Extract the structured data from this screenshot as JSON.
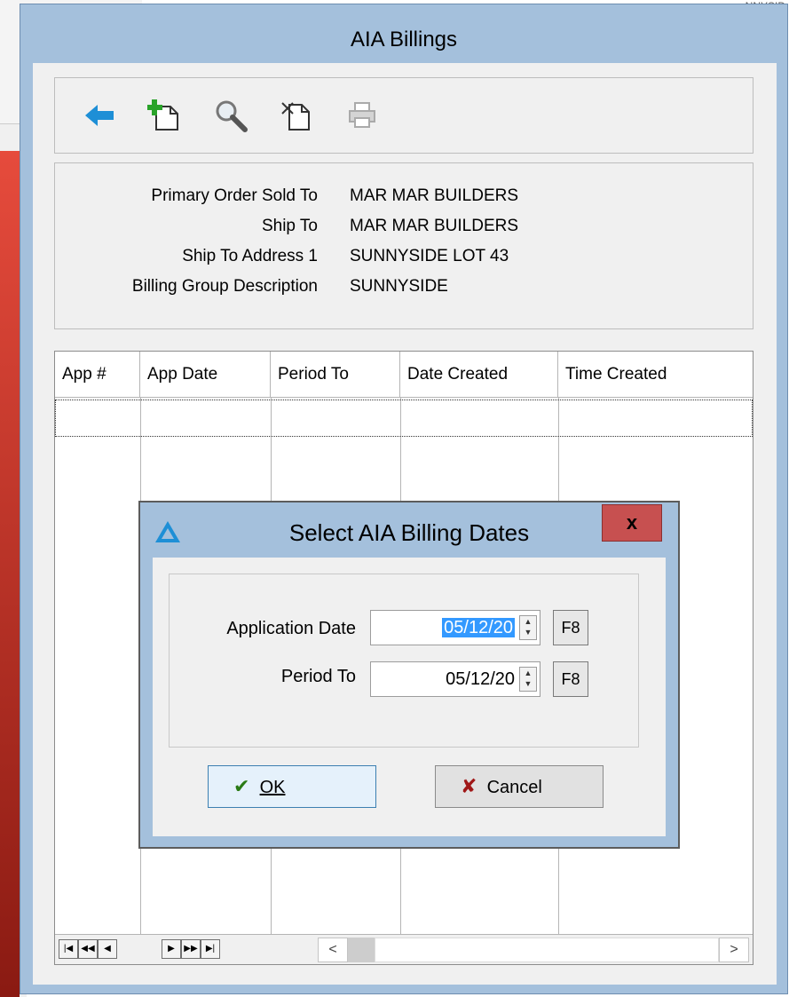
{
  "window": {
    "title": "AIA Billings"
  },
  "background": {
    "topright_text": "NNYSID"
  },
  "toolbar": {
    "buttons": [
      {
        "name": "back-arrow-icon"
      },
      {
        "name": "add-new-icon"
      },
      {
        "name": "search-icon"
      },
      {
        "name": "delete-icon"
      },
      {
        "name": "print-icon"
      }
    ]
  },
  "info": {
    "primary_order_sold_to_label": "Primary Order Sold To",
    "primary_order_sold_to_value": "MAR MAR BUILDERS",
    "ship_to_label": "Ship To",
    "ship_to_value": "MAR MAR BUILDERS",
    "ship_to_address1_label": "Ship To Address 1",
    "ship_to_address1_value": "SUNNYSIDE LOT 43",
    "billing_group_label": "Billing Group Description",
    "billing_group_value": "SUNNYSIDE"
  },
  "grid": {
    "columns": [
      "App #",
      "App Date",
      "Period To",
      "Date Created",
      "Time Created"
    ],
    "nav_buttons": [
      "first",
      "prev-page",
      "prev",
      "next",
      "next-page",
      "last"
    ]
  },
  "dialog": {
    "title": "Select AIA Billing Dates",
    "close_label": "x",
    "application_date_label": "Application Date",
    "application_date_value": "05/12/20",
    "period_to_label": "Period To",
    "period_to_value": "05/12/20",
    "f8_label": "F8",
    "ok_label": "OK",
    "cancel_label": "Cancel"
  },
  "colors": {
    "window_frame": "#a4c0dc",
    "client": "#f0f0f0",
    "close_button": "#c75050",
    "selection": "#3399ff"
  }
}
